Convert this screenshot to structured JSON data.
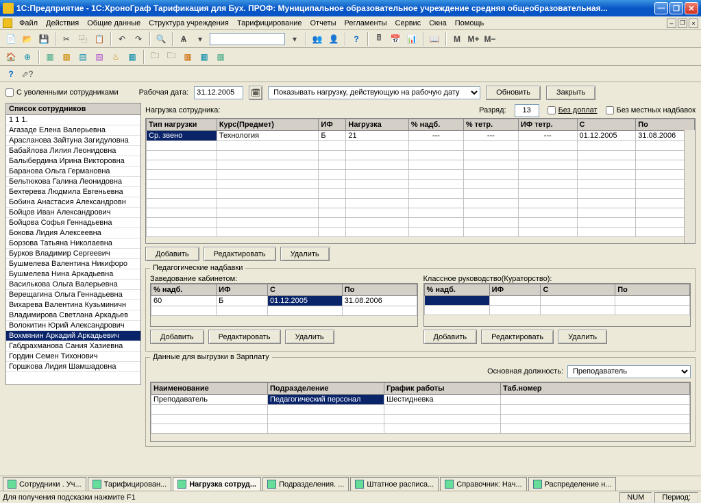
{
  "window": {
    "title": "1С:Предприятие - 1С:ХроноГраф Тарификация для Бух. ПРОФ: Муниципальное образовательное учреждение средняя общеобразовательная..."
  },
  "menu": [
    "Файл",
    "Действия",
    "Общие данные",
    "Структура учреждения",
    "Тарифицирование",
    "Отчеты",
    "Регламенты",
    "Сервис",
    "Окна",
    "Помощь"
  ],
  "form": {
    "dismissed_label": "С уволенными сотрудниками",
    "workdate_label": "Рабочая дата:",
    "workdate": "31.12.2005",
    "filter_option": "Показывать нагрузку, действующую на рабочую дату",
    "refresh_btn": "Обновить",
    "close_btn": "Закрыть"
  },
  "emp_list": {
    "header": "Список сотрудников",
    "items": [
      "1 1 1.",
      "Агазаде Елена Валерьевна",
      "Арасланова Зайтуна Загидуловна",
      "Бабайлова Лилия Леонидовна",
      "Балыбердина Ирина Викторовна",
      "Баранова Ольга Германовна",
      "Бельтюкова Галина Леонидовна",
      "Бехтерева Людмила Евгеньевна",
      "Бобина Анастасия Александровн",
      "Бойцов Иван Александрович",
      "Бойцова Софья Геннадьевна",
      "Бокова Лидия Алексеевна",
      "Борзова Татьяна Николаевна",
      "Бурков Владимир Сергеевич",
      "Бушмелева Валентина Никифоро",
      "Бушмелева Нина Аркадьевна",
      "Василькова Ольга Валерьевна",
      "Верещагина Ольга Геннадьевна",
      "Вихарева Валентина Кузьминичн",
      "Владимирова Светлана Аркадьев",
      "Волокитин Юрий Александрович",
      "Вохмянин Аркадий Аркадьевич",
      "Габдрахманова Сания Хазиевна",
      "Гордин Семен Тихонович",
      "Горшкова Лидия Шамшадовна"
    ],
    "selected_index": 21
  },
  "right": {
    "load_label": "Нагрузка сотрудника:",
    "rank_label": "Разряд:",
    "rank": "13",
    "no_addon_label": "Без доплат",
    "no_local_label": "Без местных надбавок"
  },
  "table_main": {
    "headers": [
      "Тип нагрузки",
      "Курс(Предмет)",
      "ИФ",
      "Нагрузка",
      "% надб.",
      "% тетр.",
      "ИФ тетр.",
      "С",
      "По"
    ],
    "row": [
      "Ср. звено",
      "Технология",
      "Б",
      "21",
      "---",
      "---",
      "---",
      "01.12.2005",
      "31.08.2006"
    ]
  },
  "buttons": {
    "add": "Добавить",
    "edit": "Редактировать",
    "del": "Удалить"
  },
  "fieldset1": {
    "legend": "Педагогические надбавки",
    "sub1": "Заведование кабинетом:",
    "sub2": "Классное руководство(Кураторство):",
    "t1_headers": [
      "% надб.",
      "ИФ",
      "С",
      "По"
    ],
    "t1_row": [
      "60",
      "Б",
      "01.12.2005",
      "31.08.2006"
    ],
    "t2_headers": [
      "% надб.",
      "ИФ",
      "С",
      "По"
    ]
  },
  "fieldset2": {
    "legend": "Данные для выгрузки в Зарплату",
    "pos_label": "Основная должность:",
    "pos_value": "Преподаватель",
    "headers": [
      "Наименование",
      "Подразделение",
      "График работы",
      "Таб.номер"
    ],
    "row": [
      "Преподаватель",
      "Педагогический персонал",
      "Шестидневка",
      ""
    ]
  },
  "tabs": [
    "Сотрудники . Уч...",
    "Тарифицирован...",
    "Нагрузка сотруд...",
    "Подразделения. ...",
    "Штатное расписа...",
    "Справочник: Нач...",
    "Распределение н..."
  ],
  "tabs_active": 2,
  "status": {
    "hint": "Для получения подсказки нажмите F1",
    "num": "NUM",
    "period": "Период:"
  }
}
